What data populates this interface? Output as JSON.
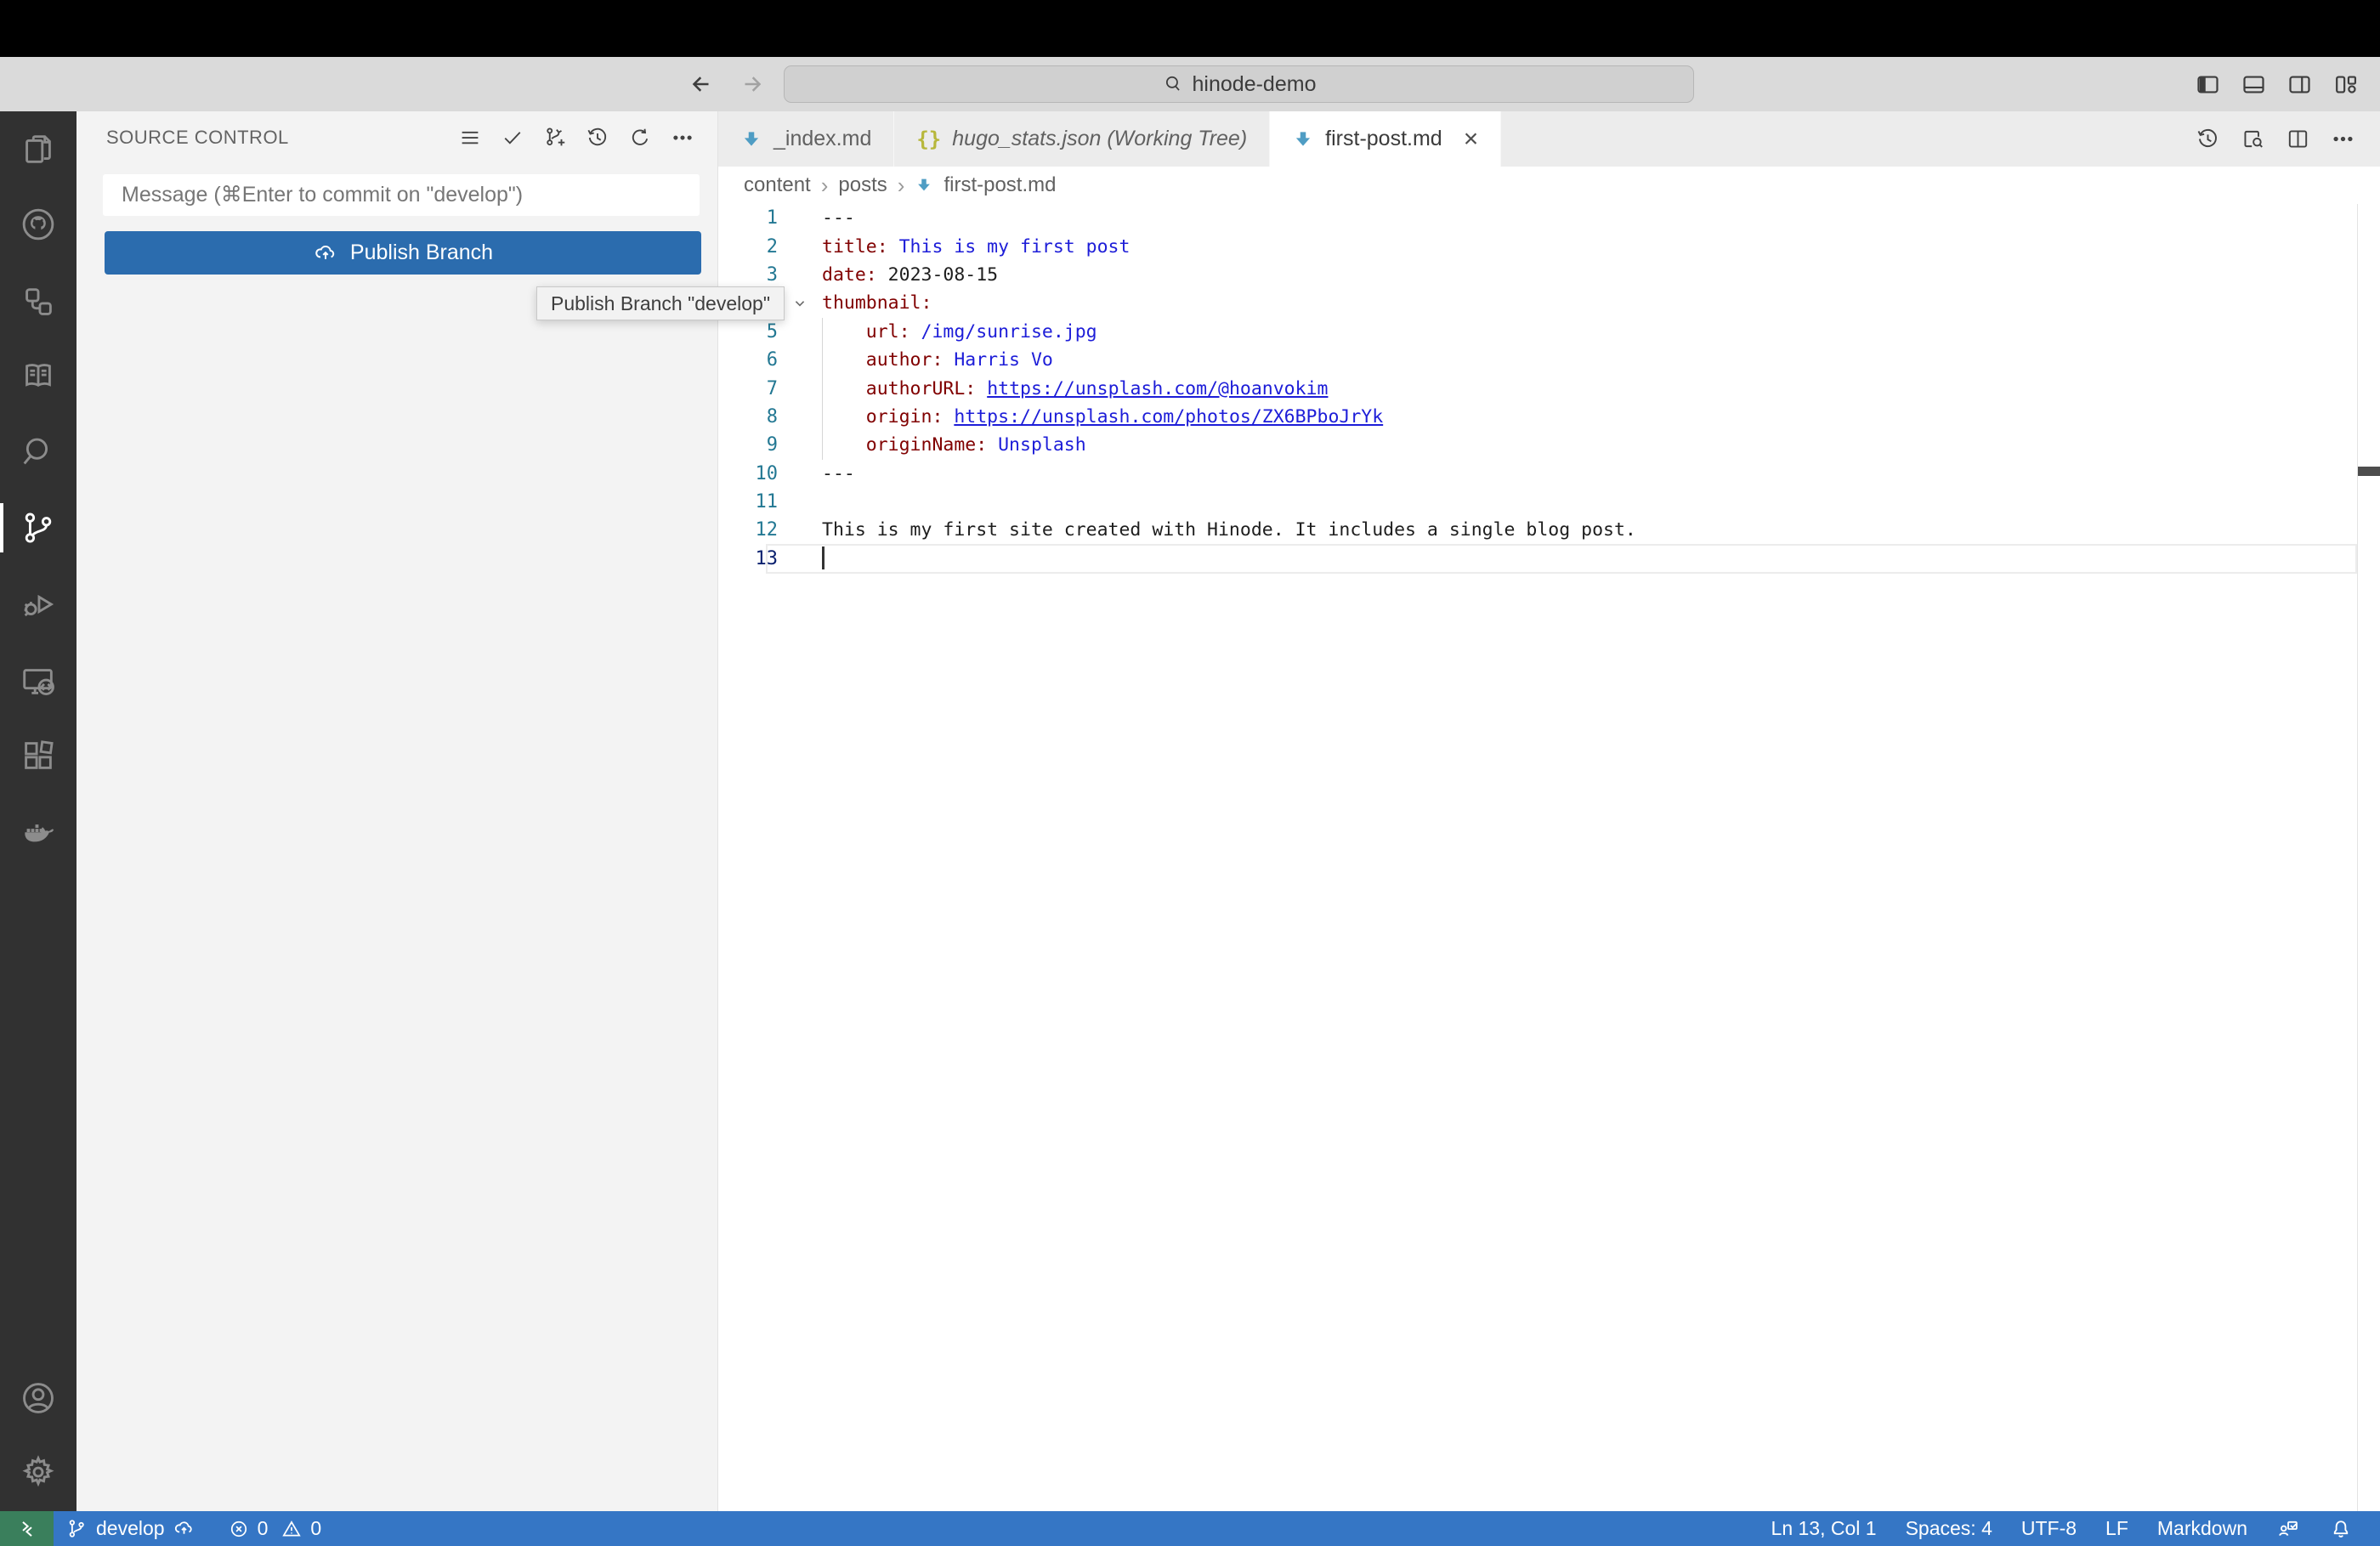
{
  "titlebar": {
    "search_value": "hinode-demo",
    "icons": [
      "back",
      "forward",
      "search",
      "toggle-primary-sidebar",
      "toggle-panel",
      "toggle-secondary-sidebar",
      "customize-layout"
    ]
  },
  "activity_bar": {
    "items": [
      "explorer",
      "github",
      "hierarchy",
      "documentation",
      "search",
      "source-control",
      "run-debug",
      "remote-explorer",
      "extensions",
      "docker"
    ],
    "bottom_items": [
      "account",
      "settings"
    ],
    "active_item": "source-control"
  },
  "sidebar": {
    "title": "SOURCE CONTROL",
    "toolbar_icons": [
      "view-as-list",
      "commit-check",
      "create-branch",
      "history",
      "refresh",
      "more-actions"
    ],
    "message_placeholder": "Message (⌘Enter to commit on \"develop\")",
    "publish_label": "Publish Branch",
    "tooltip": "Publish Branch \"develop\""
  },
  "editor": {
    "tabs": [
      {
        "label": "_index.md",
        "icon": "markdown",
        "state": "inactive"
      },
      {
        "label": "hugo_stats.json (Working Tree)",
        "icon": "json",
        "state": "inactive-preview"
      },
      {
        "label": "first-post.md",
        "icon": "markdown",
        "state": "active",
        "close": "×"
      }
    ],
    "actions": [
      "timeline-history",
      "open-preview",
      "split-editor",
      "more-actions"
    ],
    "breadcrumb": [
      "content",
      "posts",
      "first-post.md"
    ],
    "code": {
      "language": "markdown-yaml-frontmatter",
      "active_line": 13,
      "lines": [
        {
          "n": 1,
          "segs": [
            [
              "plain",
              "---"
            ]
          ]
        },
        {
          "n": 2,
          "segs": [
            [
              "key",
              "title:"
            ],
            [
              "string",
              " This is my first post"
            ]
          ]
        },
        {
          "n": 3,
          "segs": [
            [
              "key",
              "date:"
            ],
            [
              "plain",
              " 2023-08-15"
            ]
          ]
        },
        {
          "n": 4,
          "segs": [
            [
              "key",
              "thumbnail:"
            ]
          ],
          "fold": true
        },
        {
          "n": 5,
          "segs": [
            [
              "ws",
              "    "
            ],
            [
              "key",
              "url:"
            ],
            [
              "string",
              " /img/sunrise.jpg"
            ]
          ]
        },
        {
          "n": 6,
          "segs": [
            [
              "ws",
              "    "
            ],
            [
              "key",
              "author:"
            ],
            [
              "string",
              " Harris Vo"
            ]
          ]
        },
        {
          "n": 7,
          "segs": [
            [
              "ws",
              "    "
            ],
            [
              "key",
              "authorURL:"
            ],
            [
              "plain",
              " "
            ],
            [
              "link",
              "https://unsplash.com/@hoanvokim"
            ]
          ]
        },
        {
          "n": 8,
          "segs": [
            [
              "ws",
              "    "
            ],
            [
              "key",
              "origin:"
            ],
            [
              "plain",
              " "
            ],
            [
              "link",
              "https://unsplash.com/photos/ZX6BPboJrYk"
            ]
          ]
        },
        {
          "n": 9,
          "segs": [
            [
              "ws",
              "    "
            ],
            [
              "key",
              "originName:"
            ],
            [
              "string",
              " Unsplash"
            ]
          ]
        },
        {
          "n": 10,
          "segs": [
            [
              "plain",
              "---"
            ]
          ]
        },
        {
          "n": 11,
          "segs": []
        },
        {
          "n": 12,
          "segs": [
            [
              "plain",
              "This is my first site created with Hinode. It includes a single blog post."
            ]
          ]
        },
        {
          "n": 13,
          "segs": []
        }
      ]
    },
    "colors": {
      "yaml_key": "#800000",
      "yaml_string": "#1d1dd8",
      "link": "#1d1dd8",
      "line_number": "#237893",
      "active_line_number": "#0b216f",
      "markdown_icon": "#4f9dc4",
      "json_icon": "#b7b73b"
    }
  },
  "status_bar": {
    "remote_indicator": "remote",
    "branch": "develop",
    "errors": "0",
    "warnings": "0",
    "line_col": "Ln 13, Col 1",
    "spaces": "Spaces: 4",
    "encoding": "UTF-8",
    "eol": "LF",
    "language": "Markdown",
    "colors": {
      "background": "#3576c5",
      "remote_background": "#3a7f5c"
    }
  }
}
